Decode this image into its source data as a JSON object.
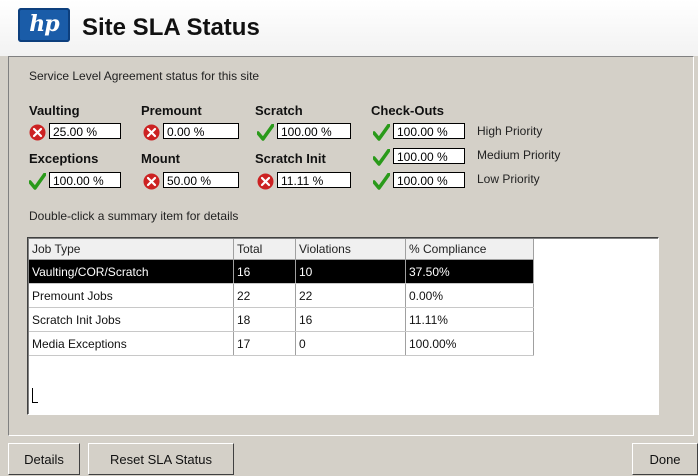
{
  "window": {
    "title": "Site SLA Status",
    "logo_text": "hp"
  },
  "subtitle": "Service Level Agreement status for this site",
  "metrics": {
    "vaulting": {
      "label": "Vaulting",
      "value": "25.00 %",
      "status": "error-icon"
    },
    "premount": {
      "label": "Premount",
      "value": "0.00 %",
      "status": "error-icon"
    },
    "scratch": {
      "label": "Scratch",
      "value": "100.00 %",
      "status": "check-icon"
    },
    "exceptions": {
      "label": "Exceptions",
      "value": "100.00 %",
      "status": "check-icon"
    },
    "mount": {
      "label": "Mount",
      "value": "50.00 %",
      "status": "error-icon"
    },
    "scratch_init": {
      "label": "Scratch Init",
      "value": "11.11 %",
      "status": "error-icon"
    }
  },
  "checkouts": {
    "label": "Check-Outs",
    "rows": [
      {
        "value": "100.00 %",
        "priority": "High Priority",
        "status": "check-icon"
      },
      {
        "value": "100.00 %",
        "priority": "Medium Priority",
        "status": "check-icon"
      },
      {
        "value": "100.00 %",
        "priority": "Low Priority",
        "status": "check-icon"
      }
    ]
  },
  "hint": "Double-click a summary item for details",
  "table": {
    "headers": [
      "Job Type",
      "Total",
      "Violations",
      "% Compliance"
    ],
    "rows": [
      [
        "Vaulting/COR/Scratch",
        "16",
        "10",
        "37.50%"
      ],
      [
        "Premount Jobs",
        "22",
        "22",
        "0.00%"
      ],
      [
        "Scratch Init Jobs",
        "18",
        "16",
        "11.11%"
      ],
      [
        "Media Exceptions",
        "17",
        "0",
        "100.00%"
      ]
    ],
    "selected_row": 0
  },
  "buttons": {
    "details": "Details",
    "reset": "Reset SLA Status",
    "done": "Done"
  },
  "colors": {
    "error": "#cc2222",
    "check": "#2a9a1a",
    "hp_blue": "#1a5ca8"
  }
}
